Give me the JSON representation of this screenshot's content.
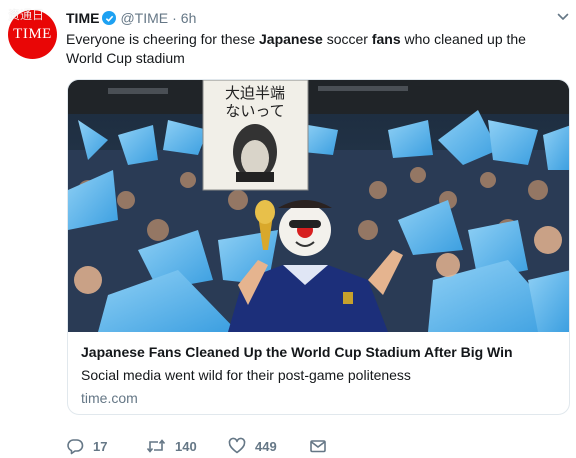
{
  "watermark": "资通日",
  "avatar": {
    "text": "TIME",
    "color": "#e90606"
  },
  "tweet": {
    "display_name": "TIME",
    "handle": "@TIME",
    "separator": "·",
    "time": "6h",
    "text_parts": [
      "Everyone is cheering for these ",
      "Japanese",
      " soccer ",
      "fans",
      " who cleaned up the World Cup stadium"
    ]
  },
  "card": {
    "image_alt": "Japanese soccer fan with painted face holding a trophy in a crowd of blue balloons",
    "banner_text_line1": "大迫半端",
    "banner_text_line2": "ないって",
    "title": "Japanese Fans Cleaned Up the World Cup Stadium After Big Win",
    "description": "Social media went wild for their post-game politeness",
    "domain": "time.com"
  },
  "actions": {
    "reply_count": "17",
    "retweet_count": "140",
    "like_count": "449"
  },
  "colors": {
    "text": "#14171a",
    "secondary": "#657786",
    "verified": "#1da1f2",
    "border": "#e1e8ed"
  },
  "icons": [
    "chevron-down-icon",
    "verified-badge-icon",
    "reply-icon",
    "retweet-icon",
    "like-icon",
    "direct-message-icon"
  ]
}
